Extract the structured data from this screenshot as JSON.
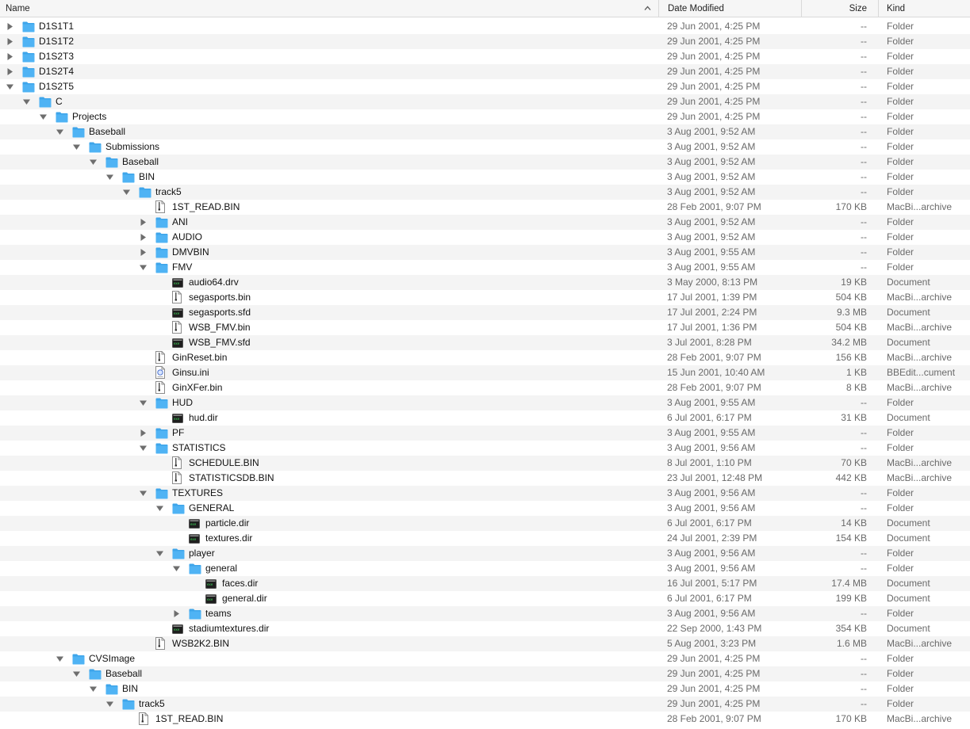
{
  "header": {
    "name": "Name",
    "date_modified": "Date Modified",
    "size": "Size",
    "kind": "Kind",
    "sort": "ascending"
  },
  "colors": {
    "folder": "#4fb3f4",
    "folder_tab": "#3ea5ea",
    "stripe": "#f4f4f4"
  },
  "rows": [
    {
      "depth": 0,
      "name": "D1S1T1",
      "date": "29 Jun 2001, 4:25 PM",
      "size": "--",
      "kind": "Folder",
      "icon": "folder",
      "disclosure": "collapsed"
    },
    {
      "depth": 0,
      "name": "D1S1T2",
      "date": "29 Jun 2001, 4:25 PM",
      "size": "--",
      "kind": "Folder",
      "icon": "folder",
      "disclosure": "collapsed"
    },
    {
      "depth": 0,
      "name": "D1S2T3",
      "date": "29 Jun 2001, 4:25 PM",
      "size": "--",
      "kind": "Folder",
      "icon": "folder",
      "disclosure": "collapsed"
    },
    {
      "depth": 0,
      "name": "D1S2T4",
      "date": "29 Jun 2001, 4:25 PM",
      "size": "--",
      "kind": "Folder",
      "icon": "folder",
      "disclosure": "collapsed"
    },
    {
      "depth": 0,
      "name": "D1S2T5",
      "date": "29 Jun 2001, 4:25 PM",
      "size": "--",
      "kind": "Folder",
      "icon": "folder",
      "disclosure": "expanded"
    },
    {
      "depth": 1,
      "name": "C",
      "date": "29 Jun 2001, 4:25 PM",
      "size": "--",
      "kind": "Folder",
      "icon": "folder",
      "disclosure": "expanded"
    },
    {
      "depth": 2,
      "name": "Projects",
      "date": "29 Jun 2001, 4:25 PM",
      "size": "--",
      "kind": "Folder",
      "icon": "folder",
      "disclosure": "expanded"
    },
    {
      "depth": 3,
      "name": "Baseball",
      "date": "3 Aug 2001, 9:52 AM",
      "size": "--",
      "kind": "Folder",
      "icon": "folder",
      "disclosure": "expanded"
    },
    {
      "depth": 4,
      "name": "Submissions",
      "date": "3 Aug 2001, 9:52 AM",
      "size": "--",
      "kind": "Folder",
      "icon": "folder",
      "disclosure": "expanded"
    },
    {
      "depth": 5,
      "name": "Baseball",
      "date": "3 Aug 2001, 9:52 AM",
      "size": "--",
      "kind": "Folder",
      "icon": "folder",
      "disclosure": "expanded"
    },
    {
      "depth": 6,
      "name": "BIN",
      "date": "3 Aug 2001, 9:52 AM",
      "size": "--",
      "kind": "Folder",
      "icon": "folder",
      "disclosure": "expanded"
    },
    {
      "depth": 7,
      "name": "track5",
      "date": "3 Aug 2001, 9:52 AM",
      "size": "--",
      "kind": "Folder",
      "icon": "folder",
      "disclosure": "expanded"
    },
    {
      "depth": 8,
      "name": "1ST_READ.BIN",
      "date": "28 Feb 2001, 9:07 PM",
      "size": "170 KB",
      "kind": "MacBi...archive",
      "icon": "archive",
      "disclosure": "none"
    },
    {
      "depth": 8,
      "name": "ANI",
      "date": "3 Aug 2001, 9:52 AM",
      "size": "--",
      "kind": "Folder",
      "icon": "folder",
      "disclosure": "collapsed"
    },
    {
      "depth": 8,
      "name": "AUDIO",
      "date": "3 Aug 2001, 9:52 AM",
      "size": "--",
      "kind": "Folder",
      "icon": "folder",
      "disclosure": "collapsed"
    },
    {
      "depth": 8,
      "name": "DMVBIN",
      "date": "3 Aug 2001, 9:55 AM",
      "size": "--",
      "kind": "Folder",
      "icon": "folder",
      "disclosure": "collapsed"
    },
    {
      "depth": 8,
      "name": "FMV",
      "date": "3 Aug 2001, 9:55 AM",
      "size": "--",
      "kind": "Folder",
      "icon": "folder",
      "disclosure": "expanded"
    },
    {
      "depth": 9,
      "name": "audio64.drv",
      "date": "3 May 2000, 8:13 PM",
      "size": "19 KB",
      "kind": "Document",
      "icon": "exec",
      "disclosure": "none"
    },
    {
      "depth": 9,
      "name": "segasports.bin",
      "date": "17 Jul 2001, 1:39 PM",
      "size": "504 KB",
      "kind": "MacBi...archive",
      "icon": "archive",
      "disclosure": "none"
    },
    {
      "depth": 9,
      "name": "segasports.sfd",
      "date": "17 Jul 2001, 2:24 PM",
      "size": "9.3 MB",
      "kind": "Document",
      "icon": "exec",
      "disclosure": "none"
    },
    {
      "depth": 9,
      "name": "WSB_FMV.bin",
      "date": "17 Jul 2001, 1:36 PM",
      "size": "504 KB",
      "kind": "MacBi...archive",
      "icon": "archive",
      "disclosure": "none"
    },
    {
      "depth": 9,
      "name": "WSB_FMV.sfd",
      "date": "3 Jul 2001, 8:28 PM",
      "size": "34.2 MB",
      "kind": "Document",
      "icon": "exec",
      "disclosure": "none"
    },
    {
      "depth": 8,
      "name": "GinReset.bin",
      "date": "28 Feb 2001, 9:07 PM",
      "size": "156 KB",
      "kind": "MacBi...archive",
      "icon": "archive",
      "disclosure": "none"
    },
    {
      "depth": 8,
      "name": "Ginsu.ini",
      "date": "15 Jun 2001, 10:40 AM",
      "size": "1 KB",
      "kind": "BBEdit...cument",
      "icon": "text",
      "disclosure": "none"
    },
    {
      "depth": 8,
      "name": "GinXFer.bin",
      "date": "28 Feb 2001, 9:07 PM",
      "size": "8 KB",
      "kind": "MacBi...archive",
      "icon": "archive",
      "disclosure": "none"
    },
    {
      "depth": 8,
      "name": "HUD",
      "date": "3 Aug 2001, 9:55 AM",
      "size": "--",
      "kind": "Folder",
      "icon": "folder",
      "disclosure": "expanded"
    },
    {
      "depth": 9,
      "name": "hud.dir",
      "date": "6 Jul 2001, 6:17 PM",
      "size": "31 KB",
      "kind": "Document",
      "icon": "exec",
      "disclosure": "none"
    },
    {
      "depth": 8,
      "name": "PF",
      "date": "3 Aug 2001, 9:55 AM",
      "size": "--",
      "kind": "Folder",
      "icon": "folder",
      "disclosure": "collapsed"
    },
    {
      "depth": 8,
      "name": "STATISTICS",
      "date": "3 Aug 2001, 9:56 AM",
      "size": "--",
      "kind": "Folder",
      "icon": "folder",
      "disclosure": "expanded"
    },
    {
      "depth": 9,
      "name": "SCHEDULE.BIN",
      "date": "8 Jul 2001, 1:10 PM",
      "size": "70 KB",
      "kind": "MacBi...archive",
      "icon": "archive",
      "disclosure": "none"
    },
    {
      "depth": 9,
      "name": "STATISTICSDB.BIN",
      "date": "23 Jul 2001, 12:48 PM",
      "size": "442 KB",
      "kind": "MacBi...archive",
      "icon": "archive",
      "disclosure": "none"
    },
    {
      "depth": 8,
      "name": "TEXTURES",
      "date": "3 Aug 2001, 9:56 AM",
      "size": "--",
      "kind": "Folder",
      "icon": "folder",
      "disclosure": "expanded"
    },
    {
      "depth": 9,
      "name": "GENERAL",
      "date": "3 Aug 2001, 9:56 AM",
      "size": "--",
      "kind": "Folder",
      "icon": "folder",
      "disclosure": "expanded"
    },
    {
      "depth": 10,
      "name": "particle.dir",
      "date": "6 Jul 2001, 6:17 PM",
      "size": "14 KB",
      "kind": "Document",
      "icon": "exec",
      "disclosure": "none"
    },
    {
      "depth": 10,
      "name": "textures.dir",
      "date": "24 Jul 2001, 2:39 PM",
      "size": "154 KB",
      "kind": "Document",
      "icon": "exec",
      "disclosure": "none"
    },
    {
      "depth": 9,
      "name": "player",
      "date": "3 Aug 2001, 9:56 AM",
      "size": "--",
      "kind": "Folder",
      "icon": "folder",
      "disclosure": "expanded"
    },
    {
      "depth": 10,
      "name": "general",
      "date": "3 Aug 2001, 9:56 AM",
      "size": "--",
      "kind": "Folder",
      "icon": "folder",
      "disclosure": "expanded"
    },
    {
      "depth": 11,
      "name": "faces.dir",
      "date": "16 Jul 2001, 5:17 PM",
      "size": "17.4 MB",
      "kind": "Document",
      "icon": "exec",
      "disclosure": "none"
    },
    {
      "depth": 11,
      "name": "general.dir",
      "date": "6 Jul 2001, 6:17 PM",
      "size": "199 KB",
      "kind": "Document",
      "icon": "exec",
      "disclosure": "none"
    },
    {
      "depth": 10,
      "name": "teams",
      "date": "3 Aug 2001, 9:56 AM",
      "size": "--",
      "kind": "Folder",
      "icon": "folder",
      "disclosure": "collapsed"
    },
    {
      "depth": 9,
      "name": "stadiumtextures.dir",
      "date": "22 Sep 2000, 1:43 PM",
      "size": "354 KB",
      "kind": "Document",
      "icon": "exec",
      "disclosure": "none"
    },
    {
      "depth": 8,
      "name": "WSB2K2.BIN",
      "date": "5 Aug 2001, 3:23 PM",
      "size": "1.6 MB",
      "kind": "MacBi...archive",
      "icon": "archive",
      "disclosure": "none"
    },
    {
      "depth": 3,
      "name": "CVSImage",
      "date": "29 Jun 2001, 4:25 PM",
      "size": "--",
      "kind": "Folder",
      "icon": "folder",
      "disclosure": "expanded"
    },
    {
      "depth": 4,
      "name": "Baseball",
      "date": "29 Jun 2001, 4:25 PM",
      "size": "--",
      "kind": "Folder",
      "icon": "folder",
      "disclosure": "expanded"
    },
    {
      "depth": 5,
      "name": "BIN",
      "date": "29 Jun 2001, 4:25 PM",
      "size": "--",
      "kind": "Folder",
      "icon": "folder",
      "disclosure": "expanded"
    },
    {
      "depth": 6,
      "name": "track5",
      "date": "29 Jun 2001, 4:25 PM",
      "size": "--",
      "kind": "Folder",
      "icon": "folder",
      "disclosure": "expanded"
    },
    {
      "depth": 7,
      "name": "1ST_READ.BIN",
      "date": "28 Feb 2001, 9:07 PM",
      "size": "170 KB",
      "kind": "MacBi...archive",
      "icon": "archive",
      "disclosure": "none"
    }
  ]
}
